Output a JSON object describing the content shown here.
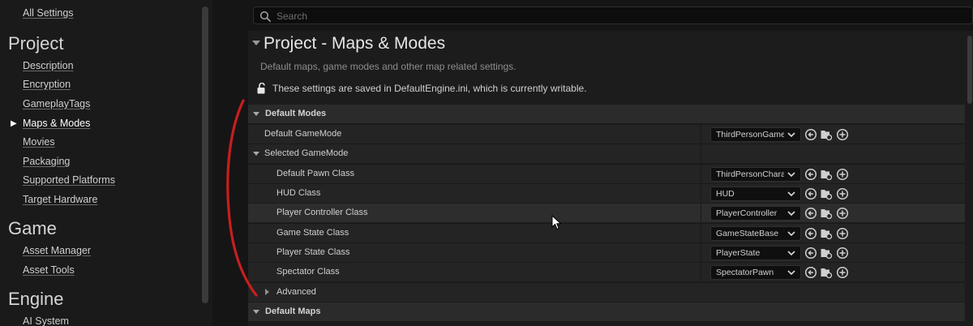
{
  "sidebar": {
    "all_settings": "All Settings",
    "sections": [
      {
        "title": "Project"
      },
      {
        "title": "Game"
      },
      {
        "title": "Engine"
      }
    ],
    "project_items": [
      "Description",
      "Encryption",
      "GameplayTags",
      "Maps & Modes",
      "Movies",
      "Packaging",
      "Supported Platforms",
      "Target Hardware"
    ],
    "game_items": [
      "Asset Manager",
      "Asset Tools"
    ],
    "engine_items": [
      "AI System"
    ],
    "active_item": "Maps & Modes"
  },
  "search": {
    "placeholder": "Search"
  },
  "header": {
    "title": "Project - Maps & Modes",
    "subtitle": "Default maps, game modes and other map related settings.",
    "save_notice": "These settings are saved in DefaultEngine.ini, which is currently writable."
  },
  "grid": {
    "default_modes": "Default Modes",
    "default_gamemode_label": "Default GameMode",
    "default_gamemode_value": "ThirdPersonGame",
    "selected_gamemode": "Selected GameMode",
    "rows": [
      {
        "label": "Default Pawn Class",
        "value": "ThirdPersonChara"
      },
      {
        "label": "HUD Class",
        "value": "HUD"
      },
      {
        "label": "Player Controller Class",
        "value": "PlayerController"
      },
      {
        "label": "Game State Class",
        "value": "GameStateBase"
      },
      {
        "label": "Player State Class",
        "value": "PlayerState"
      },
      {
        "label": "Spectator Class",
        "value": "SpectatorPawn"
      }
    ],
    "advanced": "Advanced",
    "default_maps": "Default Maps"
  },
  "icons": [
    "search-icon",
    "lock-open-icon",
    "use-selected-icon",
    "browse-folder-icon",
    "add-new-icon",
    "chevron-down-icon",
    "mouse-cursor-icon"
  ],
  "colors": {
    "background": "#1c1c1c",
    "category": "#2b2b2b",
    "annotation": "#c81e1e"
  }
}
